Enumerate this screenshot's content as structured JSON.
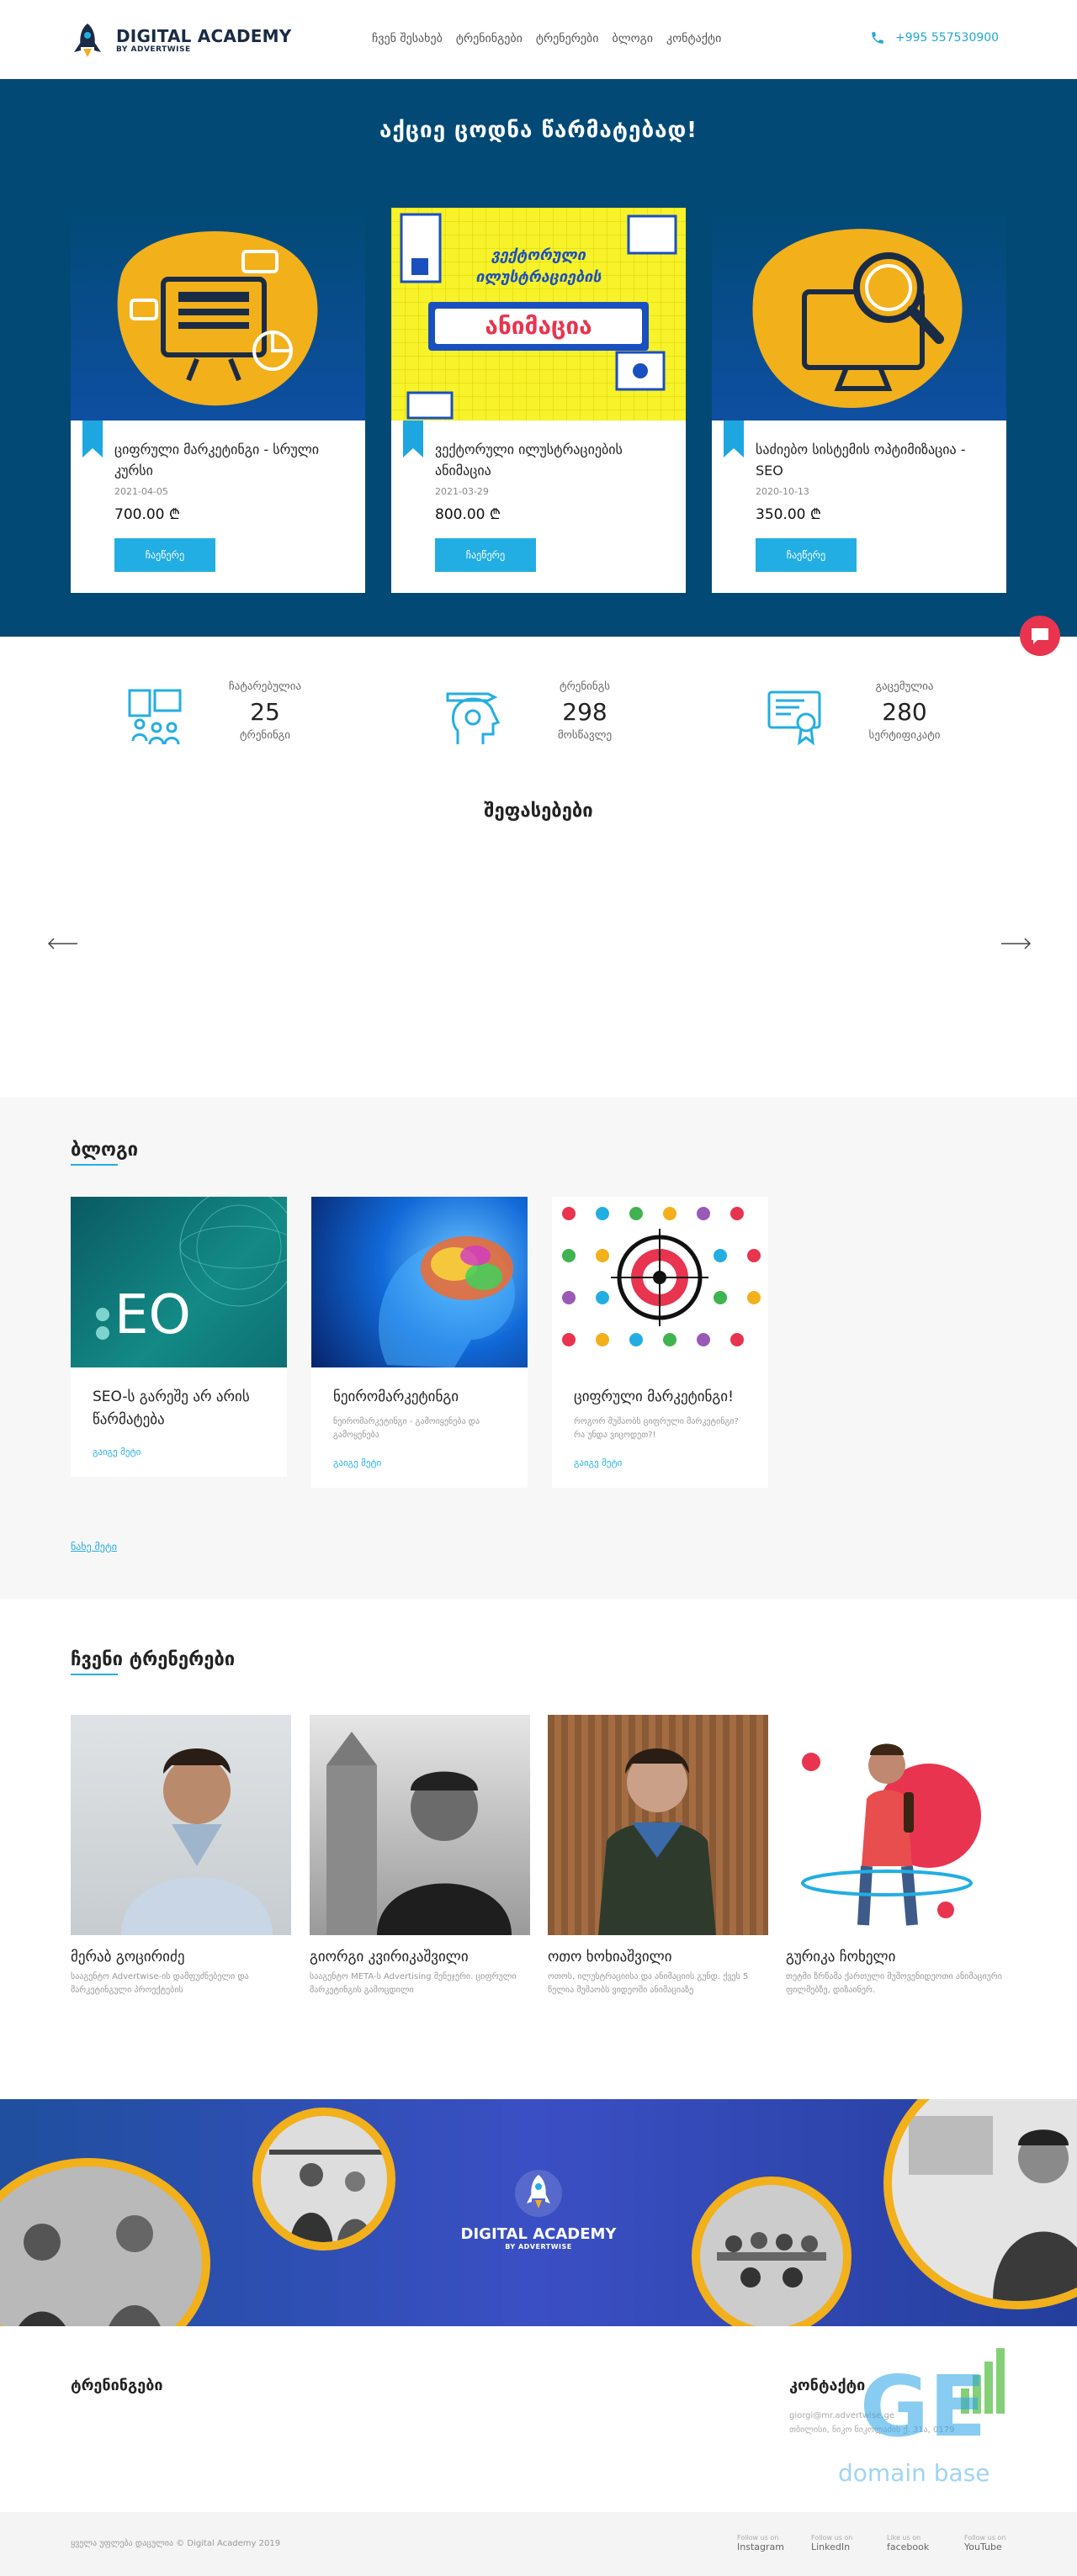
{
  "header": {
    "brand_title": "DIGITAL ACADEMY",
    "brand_sub": "BY ADVERTWISE",
    "nav": [
      "ჩვენ შესახებ",
      "ტრენინგები",
      "ტრენერები",
      "ბლოგი",
      "კონტაქტი"
    ],
    "phone": "+995 557530900"
  },
  "hero": {
    "title": "აქციე ცოდნა წარმატებად!",
    "courses": [
      {
        "title": "ციფრული მარკეტინგი - სრული კურსი",
        "date": "2021-04-05",
        "price": "700.00 ₾",
        "button": "ჩაეწერე",
        "image_icon": "presentation-board-icon"
      },
      {
        "title": "ვექტორული ილუსტრაციების ანიმაცია",
        "date": "2021-03-29",
        "price": "800.00 ₾",
        "button": "ჩაეწერე",
        "image_icon": "vector-animation-poster",
        "poster_line1": "ვექტორული",
        "poster_line2": "ილუსტრაციების",
        "poster_line3": "ანიმაცია"
      },
      {
        "title": "საძიებო სისტემის ოპტიმიზაცია - SEO",
        "date": "2020-10-13",
        "price": "350.00 ₾",
        "button": "ჩაეწერე",
        "image_icon": "monitor-magnifier-icon"
      }
    ],
    "accent_color": "#f2b01b",
    "bg_color": "#024a75"
  },
  "stats": [
    {
      "top": "ჩატარებულია",
      "number": "25",
      "bottom": "ტრენინგი",
      "icon": "presenter-audience-icon"
    },
    {
      "top": "ტრენინგს",
      "number": "298",
      "bottom": "მოსწავლე",
      "icon": "head-pencil-icon"
    },
    {
      "top": "გაცემულია",
      "number": "280",
      "bottom": "სერტიფიკატი",
      "icon": "certificate-icon"
    }
  ],
  "reviews": {
    "title": "შეფასებები"
  },
  "blog": {
    "title": "ბლოგი",
    "posts": [
      {
        "title": "SEO-ს გარეშე არ არის წარმატება",
        "excerpt": "",
        "more": "გაიგე მეტი",
        "image_text": "EO"
      },
      {
        "title": "ნეირომარკეტინგი",
        "excerpt": "ნეირომარკეტინგი - გამოიყენება და გამოყენება",
        "more": "გაიგე მეტი"
      },
      {
        "title": "ციფრული მარკეტინგი!",
        "excerpt": "როგორ მუშაობს ციფრული მარკეტინგი? რა უნდა ვიცოდეთ?!",
        "more": "გაიგე მეტი"
      }
    ],
    "see_more": "ნახე მეტი"
  },
  "trainers": {
    "title": "ჩვენი ტრენერები",
    "people": [
      {
        "name": "მერაბ გოცირიძე",
        "desc": "სააგენტო Advertwise-ის დამფუძნებელი და მარკეტინგული პროექტების"
      },
      {
        "name": "გიორგი კვირიკაშვილი",
        "desc": "სააგენტო META-ს Advertising მენეჯერი. ციფრული მარკეტინგის გამოცდილი"
      },
      {
        "name": "ოთო ხოხიაშვილი",
        "desc": "ოთოს, ილუსტრაციისა და ანიმაციის გუნდ. ქვეს 5 წელია მუშაობს ვიდეოში ანიმაციაზე"
      },
      {
        "name": "გურიკა ჩოხელი",
        "desc": "თეტმი ზრწამა ქართული მუშოვენიდეოთი ანიმაციური ფილმებზე, დიზაინერ."
      }
    ]
  },
  "banner": {
    "brand_title": "DIGITAL ACADEMY",
    "brand_sub": "BY ADVERTWISE"
  },
  "footer": {
    "trainings_title": "ტრენინგები",
    "contact_title": "კონტაქტი",
    "contact_lines": [
      "giorgi@mr.advertwise.ge",
      "თბილისი, ნიკო ნიკოლაძის ქ. 31ა, 0179"
    ],
    "watermark_logo": "GE",
    "watermark_text": "domain base",
    "copyright": "ყველა უფლება დაცულია © Digital Academy 2019",
    "social": [
      {
        "small": "Follow us on",
        "name": "Instagram"
      },
      {
        "small": "Follow us on",
        "name": "LinkedIn"
      },
      {
        "small": "Like us on",
        "name": "facebook"
      },
      {
        "small": "Follow us on",
        "name": "YouTube"
      }
    ]
  },
  "colors": {
    "accent": "#23aee3",
    "chat": "#e8344f"
  }
}
